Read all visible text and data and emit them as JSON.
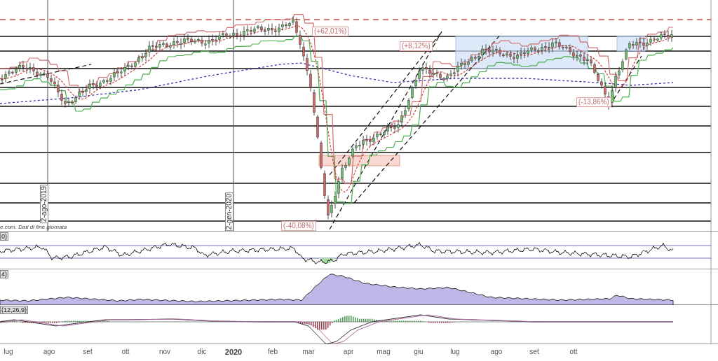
{
  "price_chart": {
    "annotations": [
      {
        "text": "(+62,01%)"
      },
      {
        "text": "(+8,12%)"
      },
      {
        "text": "(-13,86%)"
      },
      {
        "text": "(-40,08%)"
      }
    ],
    "date_markers": [
      "2-ago-2019",
      "2-gen-2020"
    ],
    "source_note": "e.com. Dati di fine giornata"
  },
  "indicators": [
    {
      "label": "0)",
      "kind": "oscillator"
    },
    {
      "label": "4)",
      "kind": "area"
    },
    {
      "label": "(12,26,9)",
      "kind": "macd"
    }
  ],
  "x_axis": {
    "labels": [
      {
        "text": "lug",
        "bold": false
      },
      {
        "text": "ago",
        "bold": false
      },
      {
        "text": "set",
        "bold": false
      },
      {
        "text": "ott",
        "bold": false
      },
      {
        "text": "nov",
        "bold": false
      },
      {
        "text": "dic",
        "bold": false
      },
      {
        "text": "2020",
        "bold": true
      },
      {
        "text": "feb",
        "bold": false
      },
      {
        "text": "mar",
        "bold": false
      },
      {
        "text": "apr",
        "bold": false
      },
      {
        "text": "mag",
        "bold": false
      },
      {
        "text": "giu",
        "bold": false
      },
      {
        "text": "lug",
        "bold": false
      },
      {
        "text": "ago",
        "bold": false
      },
      {
        "text": "set",
        "bold": false
      },
      {
        "text": "ott",
        "bold": false
      }
    ]
  }
}
